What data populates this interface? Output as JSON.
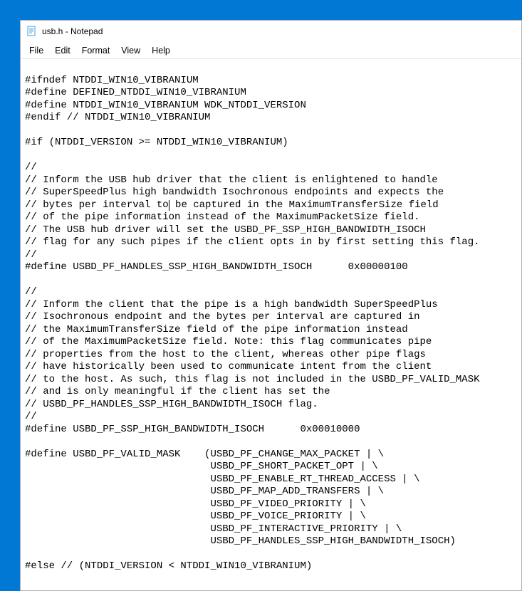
{
  "window": {
    "title": "usb.h - Notepad"
  },
  "menu": {
    "file": "File",
    "edit": "Edit",
    "format": "Format",
    "view": "View",
    "help": "Help"
  },
  "editor": {
    "before_cursor": "\n#ifndef NTDDI_WIN10_VIBRANIUM\n#define DEFINED_NTDDI_WIN10_VIBRANIUM\n#define NTDDI_WIN10_VIBRANIUM WDK_NTDDI_VERSION\n#endif // NTDDI_WIN10_VIBRANIUM\n\n#if (NTDDI_VERSION >= NTDDI_WIN10_VIBRANIUM)\n\n//\n// Inform the USB hub driver that the client is enlightened to handle\n// SuperSpeedPlus high bandwidth Isochronous endpoints and expects the\n// bytes per interval to",
    "after_cursor": " be captured in the MaximumTransferSize field\n// of the pipe information instead of the MaximumPacketSize field.\n// The USB hub driver will set the USBD_PF_SSP_HIGH_BANDWIDTH_ISOCH\n// flag for any such pipes if the client opts in by first setting this flag.\n//\n#define USBD_PF_HANDLES_SSP_HIGH_BANDWIDTH_ISOCH      0x00000100\n\n//\n// Inform the client that the pipe is a high bandwidth SuperSpeedPlus\n// Isochronous endpoint and the bytes per interval are captured in\n// the MaximumTransferSize field of the pipe information instead\n// of the MaximumPacketSize field. Note: this flag communicates pipe\n// properties from the host to the client, whereas other pipe flags\n// have historically been used to communicate intent from the client\n// to the host. As such, this flag is not included in the USBD_PF_VALID_MASK\n// and is only meaningful if the client has set the\n// USBD_PF_HANDLES_SSP_HIGH_BANDWIDTH_ISOCH flag.\n//\n#define USBD_PF_SSP_HIGH_BANDWIDTH_ISOCH      0x00010000\n\n#define USBD_PF_VALID_MASK    (USBD_PF_CHANGE_MAX_PACKET | \\\n                               USBD_PF_SHORT_PACKET_OPT | \\\n                               USBD_PF_ENABLE_RT_THREAD_ACCESS | \\\n                               USBD_PF_MAP_ADD_TRANSFERS | \\\n                               USBD_PF_VIDEO_PRIORITY | \\\n                               USBD_PF_VOICE_PRIORITY | \\\n                               USBD_PF_INTERACTIVE_PRIORITY | \\\n                               USBD_PF_HANDLES_SSP_HIGH_BANDWIDTH_ISOCH)\n\n#else // (NTDDI_VERSION < NTDDI_WIN10_VIBRANIUM)\n"
  }
}
